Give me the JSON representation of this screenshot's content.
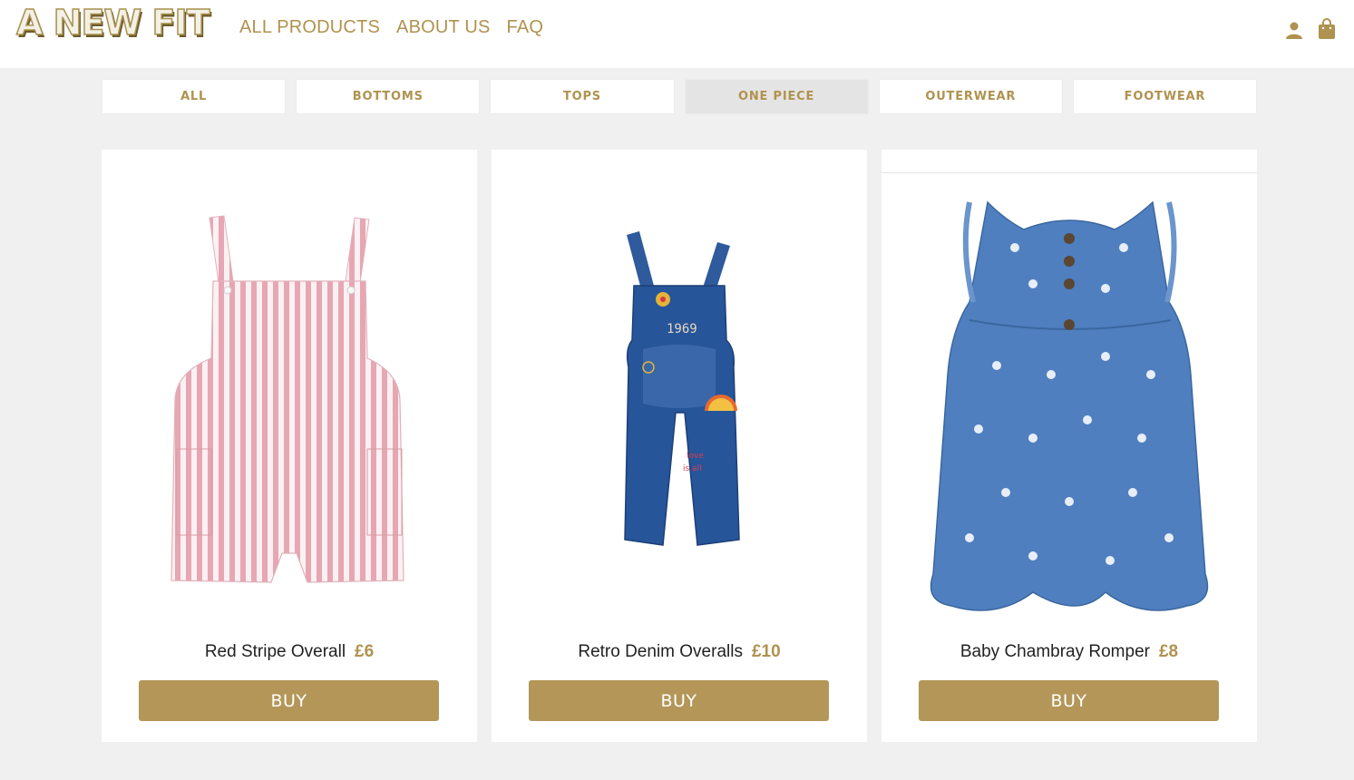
{
  "header": {
    "logo_text": "A NEW FIT",
    "nav": [
      "ALL PRODUCTS",
      "ABOUT US",
      "FAQ"
    ],
    "icons": [
      "user-icon",
      "shopping-bag-icon"
    ]
  },
  "filters": {
    "items": [
      "ALL",
      "BOTTOMS",
      "TOPS",
      "ONE PIECE",
      "OUTERWEAR",
      "FOOTWEAR"
    ],
    "active": "ONE PIECE"
  },
  "products": [
    {
      "name": "Red Stripe Overall",
      "price": "£6",
      "buy_label": "BUY"
    },
    {
      "name": "Retro Denim Overalls",
      "price": "£10",
      "buy_label": "BUY"
    },
    {
      "name": "Baby Chambray Romper",
      "price": "£8",
      "buy_label": "BUY"
    }
  ],
  "colors": {
    "accent": "#b39658",
    "nav_text": "#b0924f",
    "page_bg": "#f0f0f0",
    "active_filter_bg": "#e4e4e4"
  }
}
